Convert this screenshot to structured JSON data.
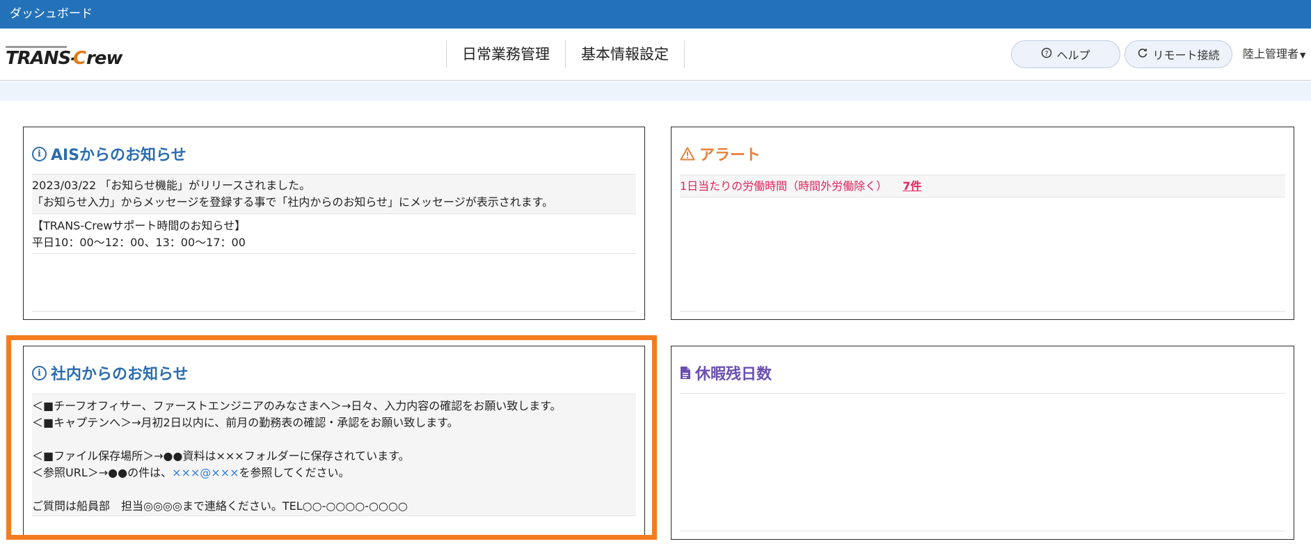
{
  "titlebar": {
    "title": "ダッシュボード"
  },
  "header": {
    "logo_text": "TRANS-Crew",
    "nav": [
      "日常業務管理",
      "基本情報設定"
    ],
    "help_label": "ヘルプ",
    "remote_label": "リモート接続",
    "user_label": "陸上管理者"
  },
  "panels": {
    "ais": {
      "title": "AISからのお知らせ",
      "messages": [
        {
          "lines": [
            "2023/03/22 「お知らせ機能」がリリースされました。",
            "「お知らせ入力」からメッセージを登録する事で「社内からのお知らせ」にメッセージが表示されます。"
          ]
        },
        {
          "lines": [
            "【TRANS-Crewサポート時間のお知らせ】",
            "平日10：00〜12：00、13：00〜17：00"
          ]
        }
      ]
    },
    "alert": {
      "title": "アラート",
      "item_text": "1日当たりの労働時間（時間外労働除く）",
      "item_count": "7件"
    },
    "company": {
      "title": "社内からのお知らせ",
      "lines": [
        "＜■チーフオフィサー、ファーストエンジニアのみなさまへ＞→日々、入力内容の確認をお願い致します。",
        "＜■キャプテンへ＞→月初2日以内に、前月の勤務表の確認・承認をお願い致します。",
        "＜■ファイル保存場所＞→●●資料は×××フォルダーに保存されています。",
        "ご質問は船員部　担当◎◎◎◎まで連絡ください。TEL○○-○○○○-○○○○"
      ],
      "ref_prefix": "＜参照URL＞→●●の件は、",
      "ref_link": "×××@×××",
      "ref_suffix": "を参照してください。"
    },
    "leave": {
      "title": "休暇残日数"
    }
  },
  "colors": {
    "titlebar": "#2372b9",
    "highlight": "#f47c20",
    "alert": "#e0245e",
    "link": "#2e7fd8"
  }
}
